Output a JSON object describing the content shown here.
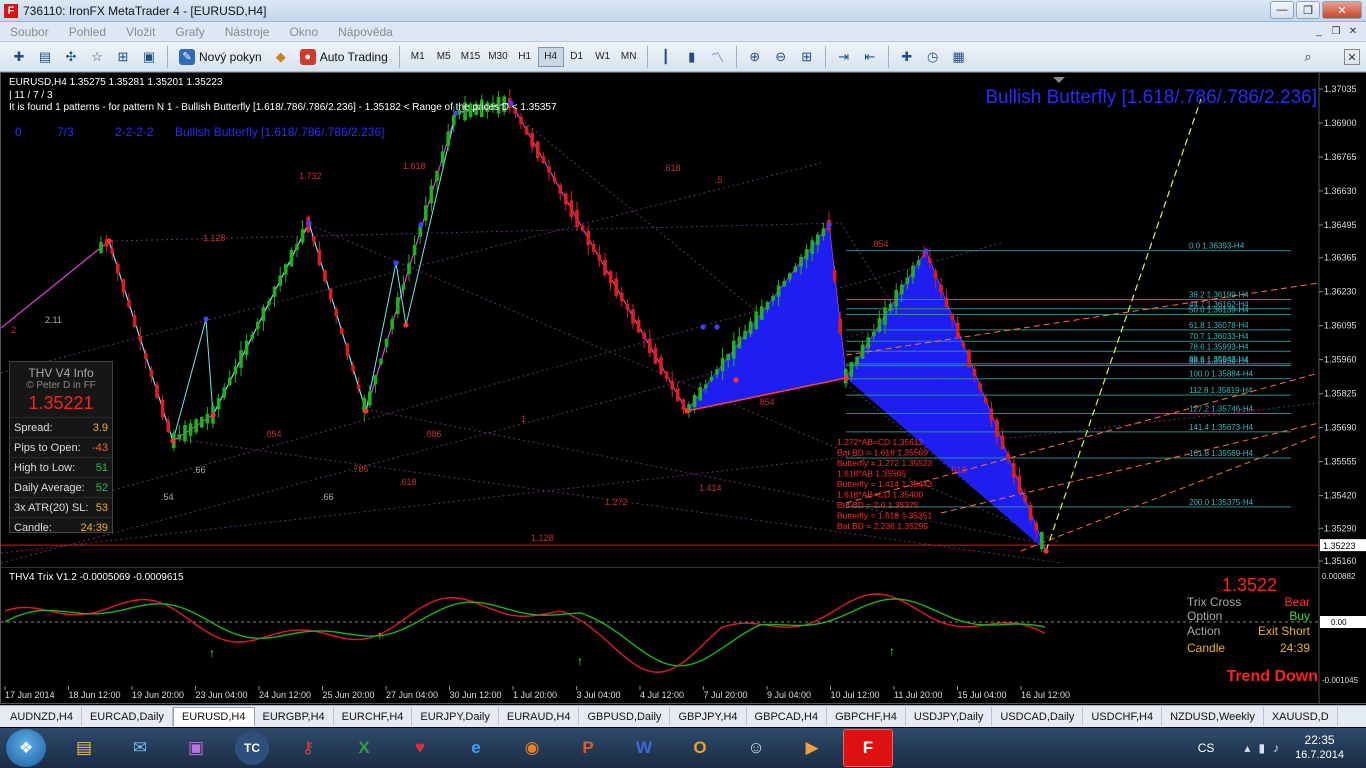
{
  "window": {
    "title": "736110: IronFX MetaTrader 4 - [EURUSD,H4]",
    "app_icon": "F",
    "controls": {
      "minimize": "—",
      "maximize": "❐",
      "close": "✕"
    }
  },
  "menu": {
    "items": [
      "Soubor",
      "Pohled",
      "Vložit",
      "Grafy",
      "Nástroje",
      "Okno",
      "Nápověda"
    ]
  },
  "toolbar": {
    "new_order": "Nový pokyn",
    "auto_trading": "Auto Trading",
    "timeframes": [
      "M1",
      "M5",
      "M15",
      "M30",
      "H1",
      "H4",
      "D1",
      "W1",
      "MN"
    ],
    "active_timeframe": "H4"
  },
  "chart": {
    "header": "EURUSD,H4  1.35275 1.35281 1.35201 1.35223",
    "line2": "| 11 / 7 / 3",
    "line3": "It is found 1 patterns  -  for pattern N 1 - Bullish Butterfly [1.618/.786/.786/2.236] - 1.35182 < Range of the prices D < 1.35357",
    "pattern_row": [
      "0",
      "7/3",
      "2-2-2-2",
      "Bullish Butterfly [1.618/.786/.786/2.236]"
    ],
    "pattern_title": "Bullish Butterfly [1.618/.786/.786/2.236]",
    "price_scale": [
      "1.37035",
      "1.36900",
      "1.36765",
      "1.36630",
      "1.36495",
      "1.36365",
      "1.36230",
      "1.36095",
      "1.35960",
      "1.35825",
      "1.35690",
      "1.35555",
      "1.35420",
      "1.35290",
      "1.35160"
    ],
    "current_price": "1.35223",
    "fib_levels": [
      {
        "pct": "0.0",
        "price": "1.36393-H4"
      },
      {
        "pct": "38.2",
        "price": "1.36199-H4"
      },
      {
        "pct": "44.7",
        "price": "1.36162-H4"
      },
      {
        "pct": "50.0",
        "price": "1.36139-H4"
      },
      {
        "pct": "61.8",
        "price": "1.36078-H4"
      },
      {
        "pct": "70.7",
        "price": "1.36033-H4"
      },
      {
        "pct": "78.6",
        "price": "1.35993-H4"
      },
      {
        "pct": "88.6",
        "price": "1.35943-H4"
      },
      {
        "pct": "88.6",
        "price": "1.35936-H4"
      },
      {
        "pct": "100.0",
        "price": "1.35884-H4"
      },
      {
        "pct": "112.8",
        "price": "1.35819-H4"
      },
      {
        "pct": "127.2",
        "price": "1.35746-H4"
      },
      {
        "pct": "141.4",
        "price": "1.35673-H4"
      },
      {
        "pct": "161.8",
        "price": "1.35569-H4"
      },
      {
        "pct": "200.0",
        "price": "1.35375-H4"
      }
    ],
    "projections": [
      "1.272*AB=CD  1.35612",
      "Bat BD = 1.618  1.35569",
      "Butterfly = 1.272  1.35523",
      "1.618*AB  1.35505",
      "Butterfly = 1.414  1.35443",
      "1.618*AB=CD  1.35400",
      "Bat BD = 2.0  1.35375",
      "Butterfly = 1.618  1.35351",
      "Bat BD = 2.236  1.35295"
    ],
    "pattern_labels": [
      "1.732",
      "1.618",
      "1.128",
      "2.11",
      ".618",
      ".5",
      ".854",
      ".854",
      ".854",
      ".886",
      ".786",
      ".618",
      "1",
      ".66",
      ".66",
      ".54",
      "1.272",
      "1.414",
      "1.128",
      "2",
      ".618",
      ".54"
    ],
    "time_axis": [
      "17 Jun 2014",
      "18 Jun 12:00",
      "19 Jun 20:00",
      "23 Jun 04:00",
      "24 Jun 12:00",
      "25 Jun 20:00",
      "27 Jun 04:00",
      "30 Jun 12:00",
      "1 Jul 20:00",
      "3 Jul 04:00",
      "4 Jul 12:00",
      "7 Jul 20:00",
      "9 Jul 04:00",
      "10 Jul 12:00",
      "11 Jul 20:00",
      "15 Jul 04:00",
      "16 Jul 12:00"
    ]
  },
  "info_panel": {
    "title": "THV  V4  Info",
    "author": "© Peter D in FF",
    "price": "1.35221",
    "rows": [
      {
        "label": "Spread:",
        "value": "3.9",
        "color": "#f0b020"
      },
      {
        "label": "Pips to Open:",
        "value": "-43",
        "color": "#ff5a2a"
      },
      {
        "label": "High to Low:",
        "value": "51",
        "color": "#20c040"
      },
      {
        "label": "Daily Average:",
        "value": "52",
        "color": "#20c040"
      },
      {
        "label": "3x ATR(20) SL:",
        "value": "53",
        "color": "#f0b020"
      },
      {
        "label": "Candle:",
        "value": "24:39",
        "color": "#f0b020"
      }
    ]
  },
  "indicator": {
    "header": "THV4 Trix V1.2 -0.0005069 -0.0009615",
    "scale": [
      "0.000882",
      "0.00",
      "-0.001045"
    ],
    "price": "1.3522",
    "labels": {
      "trix_cross": "Trix Cross",
      "trix_cross_val": "Bear",
      "option": "Option",
      "option_val": "Buy",
      "action": "Action",
      "action_val": "Exit Short",
      "candle": "Candle",
      "candle_val": "24:39",
      "trend": "Trend Down"
    }
  },
  "tabs": [
    "AUDNZD,H4",
    "EURCAD,Daily",
    "EURUSD,H4",
    "EURGBP,H4",
    "EURCHF,H4",
    "EURJPY,Daily",
    "EURAUD,H4",
    "GBPUSD,Daily",
    "GBPJPY,H4",
    "GBPCAD,H4",
    "GBPCHF,H4",
    "USDJPY,Daily",
    "USDCAD,Daily",
    "USDCHF,H4",
    "NZDUSD,Weekly",
    "XAUUSD,D"
  ],
  "active_tab": "EURUSD,H4",
  "taskbar": {
    "apps": [
      "TC",
      "Access",
      "Outlook",
      "Excel",
      "Trader",
      "IE",
      "Firefox",
      "PowerPoint",
      "Word",
      "Outlook2",
      "Agent",
      "Media",
      "MT4"
    ],
    "lang": "CS",
    "time": "22:35",
    "date": "16.7.2014"
  }
}
